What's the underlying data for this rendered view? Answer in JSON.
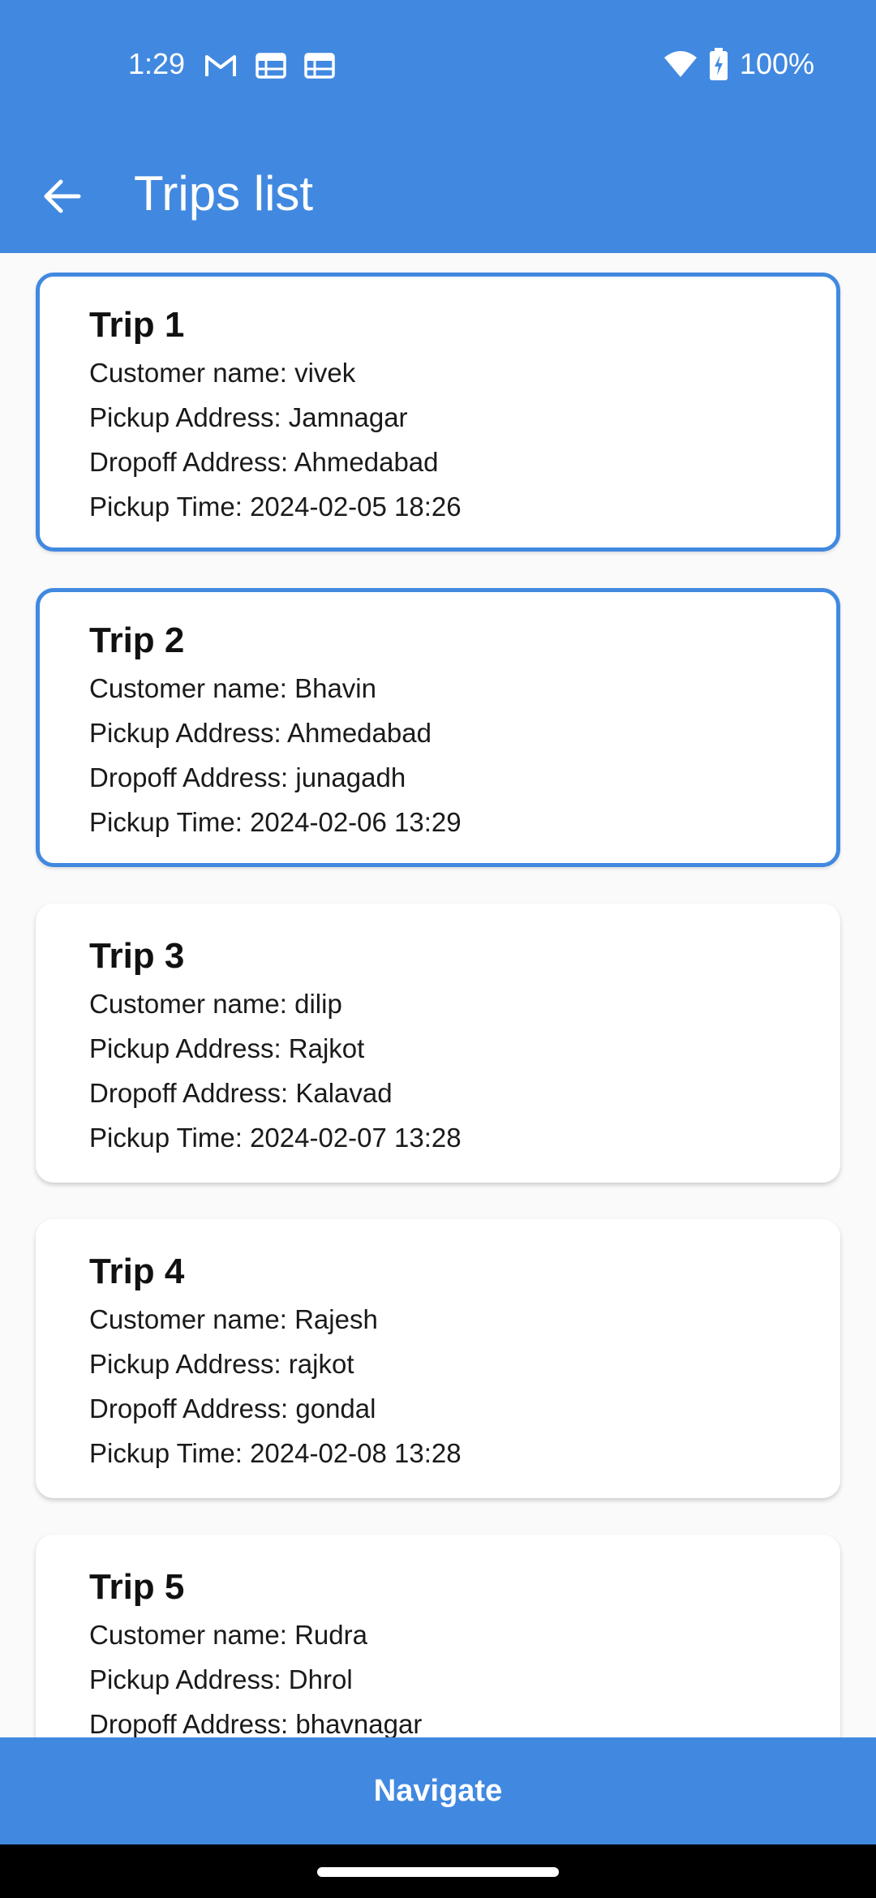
{
  "status_bar": {
    "time": "1:29",
    "battery": "100%",
    "icons": [
      "gmail-icon",
      "calendar-icon",
      "calendar-icon",
      "wifi-icon",
      "battery-charging-icon"
    ]
  },
  "app_bar": {
    "title": "Trips list",
    "back_icon": "arrow-left-icon"
  },
  "trips": [
    {
      "title": "Trip 1",
      "customer": "Customer name: vivek",
      "pickup": "Pickup Address: Jamnagar",
      "dropoff": "Dropoff Address: Ahmedabad",
      "time": "Pickup Time: 2024-02-05 18:26",
      "selected": true
    },
    {
      "title": "Trip 2",
      "customer": "Customer name: Bhavin",
      "pickup": "Pickup Address: Ahmedabad",
      "dropoff": "Dropoff Address: junagadh",
      "time": "Pickup Time: 2024-02-06 13:29",
      "selected": true
    },
    {
      "title": "Trip 3",
      "customer": "Customer name: dilip",
      "pickup": "Pickup Address: Rajkot",
      "dropoff": "Dropoff Address: Kalavad",
      "time": "Pickup Time: 2024-02-07 13:28",
      "selected": false
    },
    {
      "title": "Trip 4",
      "customer": "Customer name: Rajesh",
      "pickup": "Pickup Address: rajkot",
      "dropoff": "Dropoff Address: gondal",
      "time": "Pickup Time: 2024-02-08 13:28",
      "selected": false
    },
    {
      "title": "Trip 5",
      "customer": "Customer name: Rudra",
      "pickup": "Pickup Address: Dhrol",
      "dropoff": "Dropoff Address: bhavnagar",
      "time": "",
      "selected": false
    }
  ],
  "navigate_button": {
    "label": "Navigate"
  },
  "colors": {
    "primary": "#4189e0",
    "card_bg": "#ffffff",
    "list_bg": "#fafafa"
  }
}
